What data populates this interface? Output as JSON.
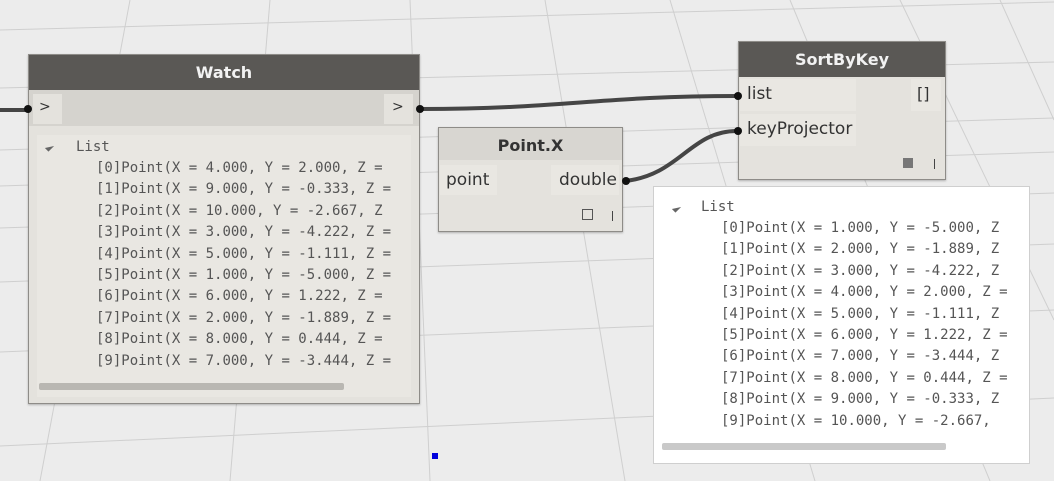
{
  "watch_node": {
    "title": "Watch",
    "input_port_label": ">",
    "output_port_label": ">",
    "list_title": "List",
    "items": [
      {
        "index": "[0]",
        "value": "Point(X = 4.000, Y = 2.000, Z ="
      },
      {
        "index": "[1]",
        "value": "Point(X = 9.000, Y = -0.333, Z ="
      },
      {
        "index": "[2]",
        "value": "Point(X = 10.000, Y = -2.667, Z"
      },
      {
        "index": "[3]",
        "value": "Point(X = 3.000, Y = -4.222, Z ="
      },
      {
        "index": "[4]",
        "value": "Point(X = 5.000, Y = -1.111, Z ="
      },
      {
        "index": "[5]",
        "value": "Point(X = 1.000, Y = -5.000, Z ="
      },
      {
        "index": "[6]",
        "value": "Point(X = 6.000, Y = 1.222, Z ="
      },
      {
        "index": "[7]",
        "value": "Point(X = 2.000, Y = -1.889, Z ="
      },
      {
        "index": "[8]",
        "value": "Point(X = 8.000, Y = 0.444, Z ="
      },
      {
        "index": "[9]",
        "value": "Point(X = 7.000, Y = -3.444, Z ="
      }
    ]
  },
  "pointx_node": {
    "title": "Point.X",
    "input_port_label": "point",
    "output_port_label": "double"
  },
  "sortbykey_node": {
    "title": "SortByKey",
    "input_ports": [
      "list",
      "keyProjector"
    ],
    "output_port_label": "[]"
  },
  "sortbykey_preview": {
    "list_title": "List",
    "items": [
      {
        "index": "[0]",
        "value": "Point(X = 1.000, Y = -5.000, Z"
      },
      {
        "index": "[1]",
        "value": "Point(X = 2.000, Y = -1.889, Z"
      },
      {
        "index": "[2]",
        "value": "Point(X = 3.000, Y = -4.222, Z"
      },
      {
        "index": "[3]",
        "value": "Point(X = 4.000, Y = 2.000, Z ="
      },
      {
        "index": "[4]",
        "value": "Point(X = 5.000, Y = -1.111, Z"
      },
      {
        "index": "[5]",
        "value": "Point(X = 6.000, Y = 1.222, Z ="
      },
      {
        "index": "[6]",
        "value": "Point(X = 7.000, Y = -3.444, Z"
      },
      {
        "index": "[7]",
        "value": "Point(X = 8.000, Y = 0.444, Z ="
      },
      {
        "index": "[8]",
        "value": "Point(X = 9.000, Y = -0.333, Z"
      },
      {
        "index": "[9]",
        "value": "Point(X = 10.000, Y = -2.667,"
      }
    ]
  },
  "colors": {
    "canvas": "#ececec",
    "grid": "#cfcfcf",
    "node_header": "#5a5855",
    "node_body": "#e4e2dd",
    "wire": "#454545",
    "selection_marker": "#0000dd"
  }
}
